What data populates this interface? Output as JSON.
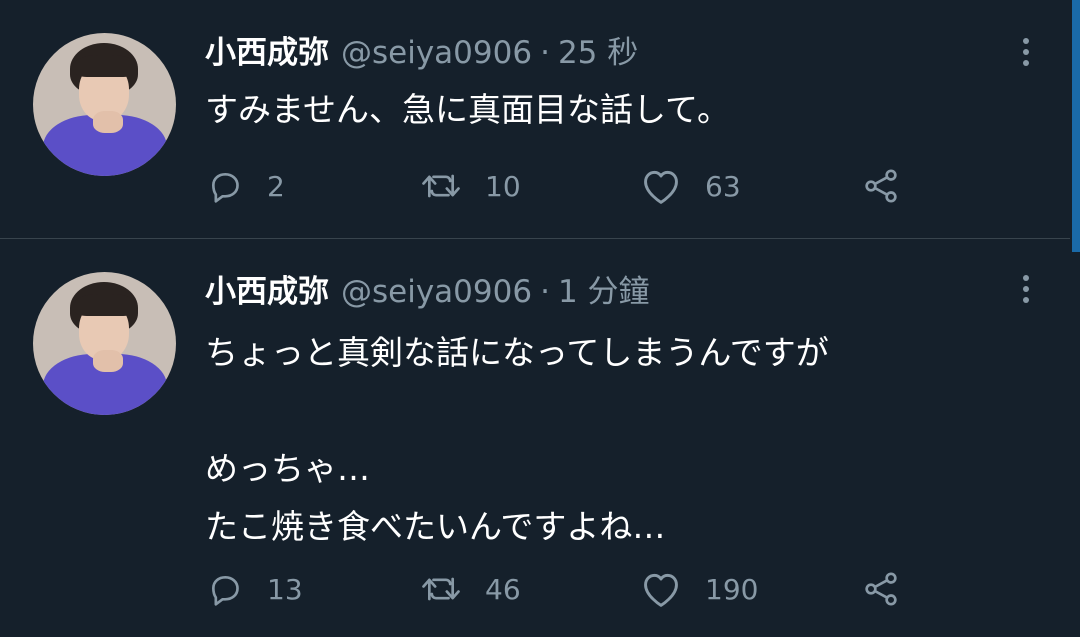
{
  "tweets": [
    {
      "name": "小西成弥",
      "handle": "@seiya0906",
      "separator": "·",
      "time": "25 秒",
      "lines": [
        "すみません、急に真面目な話して。"
      ],
      "replies": "2",
      "retweets": "10",
      "likes": "63"
    },
    {
      "name": "小西成弥",
      "handle": "@seiya0906",
      "separator": "·",
      "time": "1 分鐘",
      "lines": [
        "ちょっと真剣な話になってしまうんですが",
        "",
        "めっちゃ…",
        "たこ焼き食べたいんですよね…"
      ],
      "replies": "13",
      "retweets": "46",
      "likes": "190"
    }
  ],
  "icons": {
    "reply": "reply-icon",
    "retweet": "retweet-icon",
    "like": "heart-icon",
    "share": "share-icon",
    "more": "more-icon"
  },
  "colors": {
    "background": "#15202b",
    "secondary_text": "#8899a6",
    "divider": "#38444d",
    "scrollbar": "#1a6aa8"
  }
}
